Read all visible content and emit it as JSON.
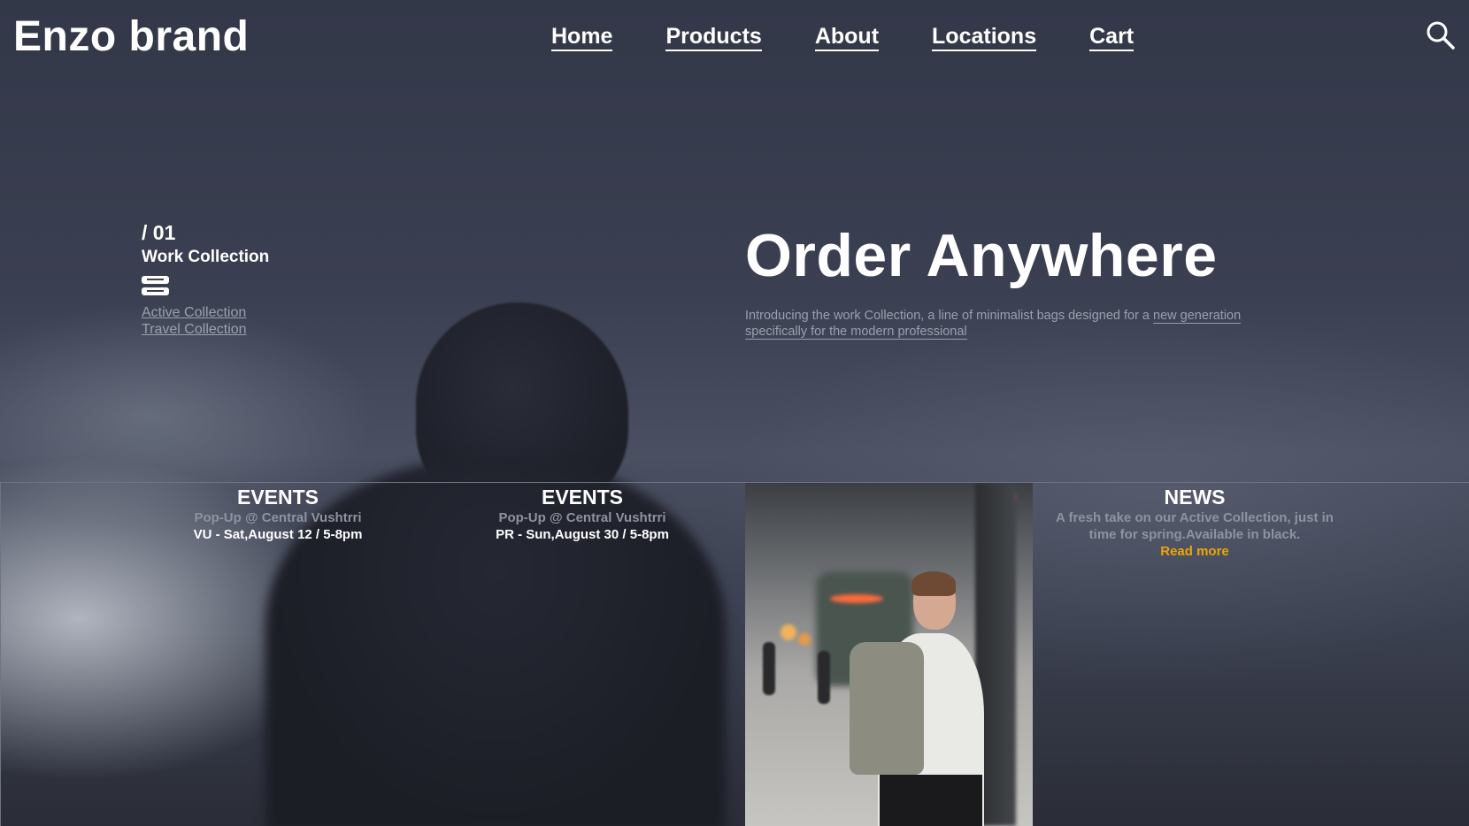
{
  "brand": {
    "name": "Enzo brand"
  },
  "nav": {
    "items": [
      {
        "label": "Home"
      },
      {
        "label": "Products"
      },
      {
        "label": "About"
      },
      {
        "label": "Locations"
      },
      {
        "label": "Cart"
      }
    ],
    "search_icon": "search-icon"
  },
  "collection": {
    "number": "/ 01",
    "title": "Work Collection",
    "icon": "server-stack-icon",
    "links": [
      {
        "label": "Active Collection"
      },
      {
        "label": "Travel Collection"
      }
    ]
  },
  "hero": {
    "title": "Order Anywhere",
    "desc_plain": "Introducing the work Collection, a line of minimalist bags designed for a ",
    "desc_link_1": "new generation",
    "desc_link_2": "specifically for the modern professional"
  },
  "events": [
    {
      "heading": "EVENTS",
      "line1": "Pop-Up @ Central Vushtrri",
      "line2": "VU - Sat,August 12 / 5-8pm"
    },
    {
      "heading": "EVENTS",
      "line1": "Pop-Up @ Central Vushtrri",
      "line2": "PR - Sun,August 30 / 5-8pm"
    }
  ],
  "news": {
    "heading": "NEWS",
    "text_1": "A fresh take on our Active Collection, just in",
    "text_2": "time for spring.Available in black.",
    "read_more": "Read more"
  },
  "colors": {
    "accent": "#f0a500",
    "muted_text": "#9aa0ad",
    "background": "#2f3444"
  }
}
